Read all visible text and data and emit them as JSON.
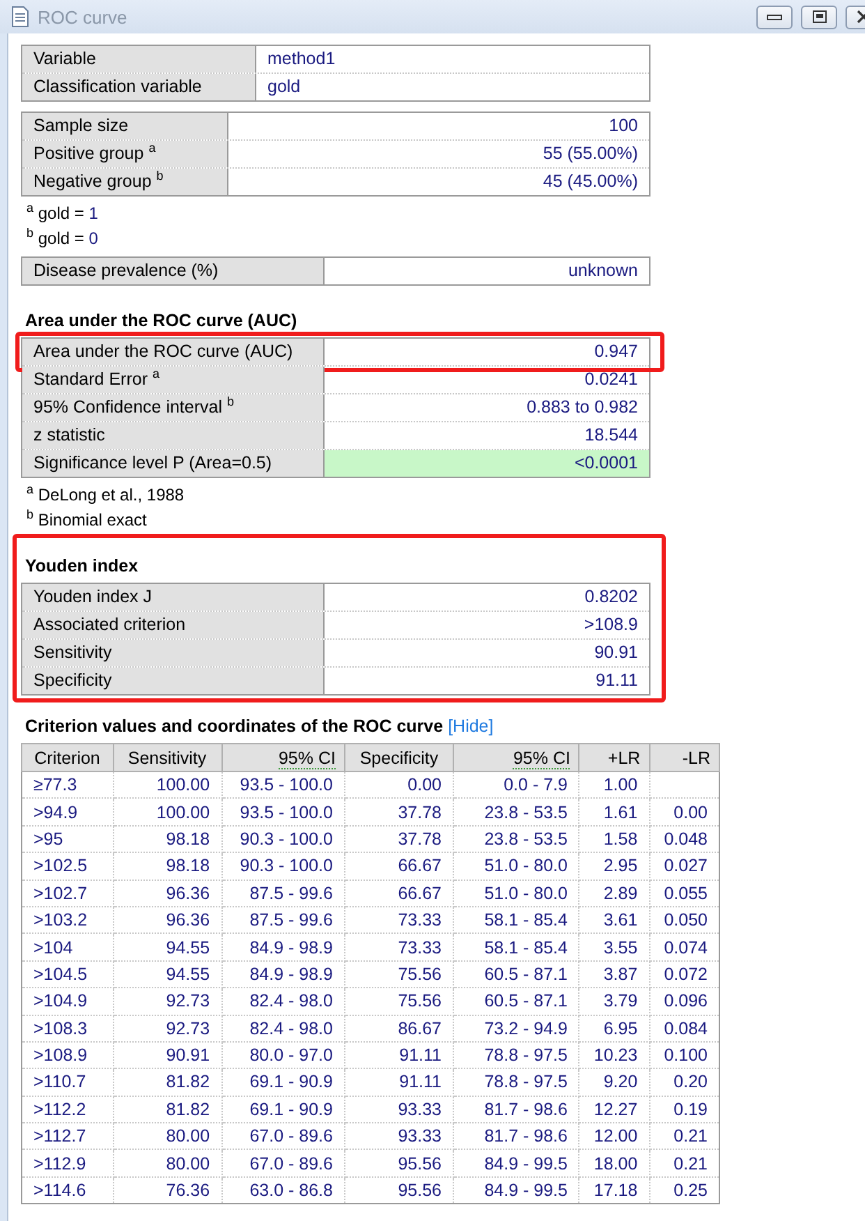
{
  "window": {
    "title": "ROC curve",
    "controls": [
      {
        "kind": "minimize"
      },
      {
        "kind": "restore"
      },
      {
        "kind": "close"
      }
    ]
  },
  "variables": {
    "rows": [
      {
        "label": "Variable",
        "value": "method1"
      },
      {
        "label": "Classification variable",
        "value": "gold"
      }
    ]
  },
  "sample": {
    "rows": [
      {
        "label": "Sample size",
        "value": "100"
      },
      {
        "label": "Positive group $^{a}$",
        "value": "55 (55.00%)"
      },
      {
        "label": "Negative group $^{b}$",
        "value": "45 (45.00%)"
      }
    ],
    "footnotes": [
      {
        "mark": "a",
        "text": "gold =",
        "value": "1"
      },
      {
        "mark": "b",
        "text": "gold =",
        "value": "0"
      }
    ]
  },
  "prevalence": {
    "rows": [
      {
        "label": "Disease prevalence (%)",
        "value": "unknown"
      }
    ]
  },
  "auc": {
    "heading": "Area under the ROC curve (AUC)",
    "rows": [
      {
        "label": "Area under the ROC curve (AUC)",
        "value": "0.947",
        "highlighted": true,
        "significant": false
      },
      {
        "label": "Standard Error $^{a}$",
        "value": "0.0241",
        "highlighted": false,
        "significant": false
      },
      {
        "label": "95% Confidence interval $^{b}$",
        "value": "0.883 to 0.982",
        "highlighted": false,
        "significant": false
      },
      {
        "label": "z statistic",
        "value": "18.544",
        "highlighted": false,
        "significant": false
      },
      {
        "label": "Significance level P (Area=0.5)",
        "value": "<0.0001",
        "highlighted": false,
        "significant": true
      }
    ],
    "footnotes": [
      {
        "mark": "a",
        "text": "DeLong et al., 1988"
      },
      {
        "mark": "b",
        "text": "Binomial exact"
      }
    ]
  },
  "youden": {
    "heading": "Youden index",
    "highlighted": true,
    "rows": [
      {
        "label": "Youden index J",
        "value": "0.8202"
      },
      {
        "label": "Associated criterion",
        "value": ">108.9"
      },
      {
        "label": "Sensitivity",
        "value": "90.91"
      },
      {
        "label": "Specificity",
        "value": "91.11"
      }
    ]
  },
  "criterion_table": {
    "heading": "Criterion values and coordinates of the ROC curve",
    "link": "[Hide]",
    "columns": [
      {
        "label": "Criterion",
        "abbr": false
      },
      {
        "label": "Sensitivity",
        "abbr": false
      },
      {
        "label": "95% CI",
        "abbr": true
      },
      {
        "label": "Specificity",
        "abbr": false
      },
      {
        "label": "95% CI",
        "abbr": true
      },
      {
        "label": "+LR",
        "abbr": false
      },
      {
        "label": "-LR",
        "abbr": false
      }
    ],
    "rows": [
      [
        "≥77.3",
        "100.00",
        "93.5 - 100.0",
        "0.00",
        "0.0 - 7.9",
        "1.00",
        null
      ],
      [
        ">94.9",
        "100.00",
        "93.5 - 100.0",
        "37.78",
        "23.8 - 53.5",
        "1.61",
        "0.00"
      ],
      [
        ">95",
        "98.18",
        "90.3 - 100.0",
        "37.78",
        "23.8 - 53.5",
        "1.58",
        "0.048"
      ],
      [
        ">102.5",
        "98.18",
        "90.3 - 100.0",
        "66.67",
        "51.0 - 80.0",
        "2.95",
        "0.027"
      ],
      [
        ">102.7",
        "96.36",
        "87.5 - 99.6",
        "66.67",
        "51.0 - 80.0",
        "2.89",
        "0.055"
      ],
      [
        ">103.2",
        "96.36",
        "87.5 - 99.6",
        "73.33",
        "58.1 - 85.4",
        "3.61",
        "0.050"
      ],
      [
        ">104",
        "94.55",
        "84.9 - 98.9",
        "73.33",
        "58.1 - 85.4",
        "3.55",
        "0.074"
      ],
      [
        ">104.5",
        "94.55",
        "84.9 - 98.9",
        "75.56",
        "60.5 - 87.1",
        "3.87",
        "0.072"
      ],
      [
        ">104.9",
        "92.73",
        "82.4 - 98.0",
        "75.56",
        "60.5 - 87.1",
        "3.79",
        "0.096"
      ],
      [
        ">108.3",
        "92.73",
        "82.4 - 98.0",
        "86.67",
        "73.2 - 94.9",
        "6.95",
        "0.084"
      ],
      [
        ">108.9",
        "90.91",
        "80.0 - 97.0",
        "91.11",
        "78.8 - 97.5",
        "10.23",
        "0.100"
      ],
      [
        ">110.7",
        "81.82",
        "69.1 - 90.9",
        "91.11",
        "78.8 - 97.5",
        "9.20",
        "0.20"
      ],
      [
        ">112.2",
        "81.82",
        "69.1 - 90.9",
        "93.33",
        "81.7 - 98.6",
        "12.27",
        "0.19"
      ],
      [
        ">112.7",
        "80.00",
        "67.0 - 89.6",
        "93.33",
        "81.7 - 98.6",
        "12.00",
        "0.21"
      ],
      [
        ">112.9",
        "80.00",
        "67.0 - 89.6",
        "95.56",
        "84.9 - 99.5",
        "18.00",
        "0.21"
      ],
      [
        ">114.6",
        "76.36",
        "63.0 - 86.8",
        "95.56",
        "84.9 - 99.5",
        "17.18",
        "0.25"
      ]
    ]
  }
}
